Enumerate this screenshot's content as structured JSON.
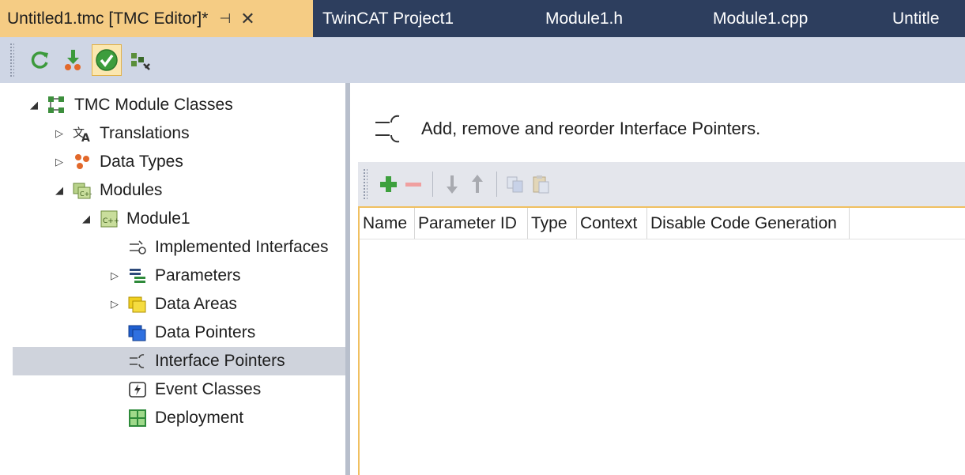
{
  "tabs": [
    {
      "label": "Untitled1.tmc [TMC Editor]*",
      "pin": "⊣",
      "close": "✕"
    },
    {
      "label": "TwinCAT Project1"
    },
    {
      "label": "Module1.h"
    },
    {
      "label": "Module1.cpp"
    },
    {
      "label": "Untitle"
    }
  ],
  "toolbar": {
    "icons": [
      "refresh-icon",
      "deploy-icon",
      "check-icon",
      "generate-icon"
    ]
  },
  "tree": [
    {
      "label": "TMC Module Classes",
      "expander": "◢",
      "icon": "module-classes-icon"
    },
    {
      "label": "Translations",
      "expander": "▷",
      "icon": "translate-icon"
    },
    {
      "label": "Data Types",
      "expander": "▷",
      "icon": "data-types-icon"
    },
    {
      "label": "Modules",
      "expander": "◢",
      "icon": "modules-icon"
    },
    {
      "label": "Module1",
      "expander": "◢",
      "icon": "module-icon"
    },
    {
      "label": "Implemented Interfaces",
      "expander": "",
      "icon": "interfaces-icon"
    },
    {
      "label": "Parameters",
      "expander": "▷",
      "icon": "parameters-icon"
    },
    {
      "label": "Data Areas",
      "expander": "▷",
      "icon": "data-areas-icon"
    },
    {
      "label": "Data Pointers",
      "expander": "",
      "icon": "data-pointers-icon"
    },
    {
      "label": "Interface Pointers",
      "expander": "",
      "icon": "interface-pointers-icon",
      "selected": true
    },
    {
      "label": "Event Classes",
      "expander": "",
      "icon": "event-classes-icon"
    },
    {
      "label": "Deployment",
      "expander": "",
      "icon": "deployment-icon"
    }
  ],
  "editor": {
    "header": "Add, remove and reorder Interface Pointers.",
    "columns": [
      "Name",
      "Parameter ID",
      "Type",
      "Context",
      "Disable Code Generation"
    ]
  },
  "colors": {
    "tab_active": "#f5cc84",
    "tabstrip": "#2d3e5e",
    "toolbar": "#cfd6e5",
    "selection": "#cfd3dc",
    "grid_border": "#f0c060"
  }
}
